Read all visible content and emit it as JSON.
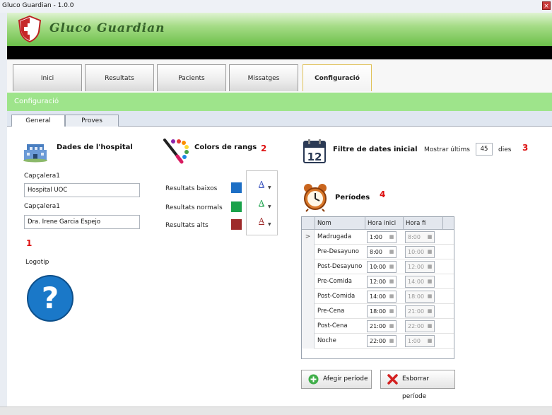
{
  "window": {
    "title": "Gluco Guardian - 1.0.0",
    "close_glyph": "×"
  },
  "banner": {
    "brand": "Gluco Guardian",
    "logo_icon": "shield-cross-icon"
  },
  "main_tabs": [
    {
      "label": "Inici"
    },
    {
      "label": "Resultats"
    },
    {
      "label": "Pacients"
    },
    {
      "label": "Missatges"
    },
    {
      "label": "Configuració",
      "active": true
    }
  ],
  "section": {
    "title": "Configuració"
  },
  "sub_tabs": [
    {
      "label": "General",
      "active": true
    },
    {
      "label": "Proves"
    }
  ],
  "hospital": {
    "heading": "Dades de l'hospital",
    "icon": "hospital-building-icon",
    "header1_label": "Capçalera1",
    "header1_value": "Hospital UOC",
    "header2_label": "Capçalera1",
    "header2_value": "Dra. Irene Garcia Espejo",
    "logo_label": "Logotip",
    "logo_icon": "question-mark-icon",
    "annotation": "1"
  },
  "colors": {
    "heading": "Colors de rangs",
    "icon": "palette-brush-icon",
    "annotation": "2",
    "ranges": [
      {
        "label": "Resultats baixos",
        "color": "#1d6fc5",
        "picker_glyph": "A",
        "underline": "#2c46b8"
      },
      {
        "label": "Resultats normals",
        "color": "#1aa24a",
        "picker_glyph": "A",
        "underline": "#1aa24a"
      },
      {
        "label": "Resultats alts",
        "color": "#9e2a2a",
        "picker_glyph": "A",
        "underline": "#9e2a2a"
      }
    ]
  },
  "date_filter": {
    "heading": "Filtre de dates inicial",
    "icon": "calendar-icon",
    "calendar_day": "12",
    "show_last_label": "Mostrar últims",
    "days_value": "45",
    "days_unit": "dies",
    "annotation": "3"
  },
  "periods": {
    "heading": "Períodes",
    "icon": "alarm-clock-icon",
    "annotation": "4",
    "columns": [
      "Nom",
      "Hora inici",
      "Hora fi"
    ],
    "current_row_marker": ">",
    "rows": [
      {
        "name": "Madrugada",
        "start": "1:00",
        "end": "8:00"
      },
      {
        "name": "Pre-Desayuno",
        "start": "8:00",
        "end": "10:00"
      },
      {
        "name": "Post-Desayuno",
        "start": "10:00",
        "end": "12:00"
      },
      {
        "name": "Pre-Comida",
        "start": "12:00",
        "end": "14:00"
      },
      {
        "name": "Post-Comida",
        "start": "14:00",
        "end": "18:00"
      },
      {
        "name": "Pre-Cena",
        "start": "18:00",
        "end": "21:00"
      },
      {
        "name": "Post-Cena",
        "start": "21:00",
        "end": "22:00"
      },
      {
        "name": "Noche",
        "start": "22:00",
        "end": "1:00"
      }
    ],
    "add_button": "Afegir període",
    "delete_button": "Esborrar període"
  },
  "theme": {
    "banner_green": "#6cc04a",
    "section_green": "#9ee48b",
    "annotation_red": "#dd1111"
  }
}
